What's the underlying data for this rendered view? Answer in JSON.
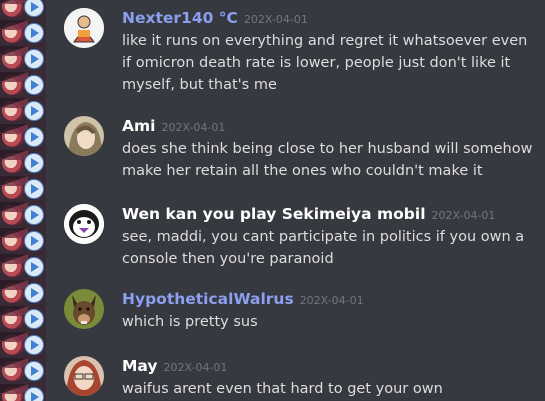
{
  "theme": {
    "background": "#36393f",
    "text": "#dcddde",
    "username_default": "#ffffff",
    "username_blurple": "#8c9ef0",
    "timestamp": "#72767d"
  },
  "messages": [
    {
      "username": "Nexter140 °C",
      "timestamp": "202X-04-01",
      "text": "like it runs on everything and regret it whatsoever even if omicron death rate is lower, people just don't like it myself, but that's me",
      "avatar_icon": "cartoon-figure-avatar",
      "name_color": "blurple"
    },
    {
      "username": "Ami",
      "timestamp": "202X-04-01",
      "text": "does she think being close to her husband will somehow make her retain all the ones who couldn't make it",
      "avatar_icon": "anime-girl-avatar",
      "name_color": "white"
    },
    {
      "username": "Wen kan you play Sekimeiya mobil",
      "timestamp": "202X-04-01",
      "text": "see, maddi, you cant participate in politics if you own a console then you're paranoid",
      "avatar_icon": "penguin-avatar",
      "name_color": "white"
    },
    {
      "username": "HypotheticalWalrus",
      "timestamp": "202X-04-01",
      "text": "which is pretty sus",
      "avatar_icon": "dog-avatar",
      "name_color": "blurple"
    },
    {
      "username": "May",
      "timestamp": "202X-04-01",
      "text": "waifus arent even that hard to get your own",
      "avatar_icon": "anime-character-avatar",
      "name_color": "white"
    }
  ]
}
